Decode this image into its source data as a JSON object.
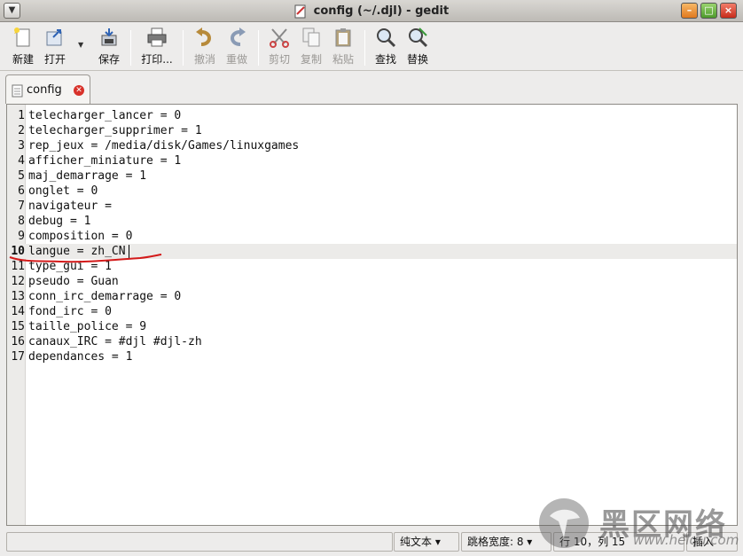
{
  "window": {
    "title": "config (~/.djl) - gedit"
  },
  "toolbar": {
    "new": "新建",
    "open": "打开",
    "save": "保存",
    "print": "打印...",
    "undo": "撤消",
    "redo": "重做",
    "cut": "剪切",
    "copy": "复制",
    "paste": "粘贴",
    "find": "查找",
    "replace": "替换"
  },
  "tab": {
    "label": "config"
  },
  "editor": {
    "current_line": 10,
    "lines": [
      {
        "n": "1",
        "text": "telecharger_lancer = 0"
      },
      {
        "n": "2",
        "text": "telecharger_supprimer = 1"
      },
      {
        "n": "3",
        "text": "rep_jeux = /media/disk/Games/linuxgames"
      },
      {
        "n": "4",
        "text": "afficher_miniature = 1"
      },
      {
        "n": "5",
        "text": "maj_demarrage = 1"
      },
      {
        "n": "6",
        "text": "onglet = 0"
      },
      {
        "n": "7",
        "text": "navigateur ="
      },
      {
        "n": "8",
        "text": "debug = 1"
      },
      {
        "n": "9",
        "text": "composition = 0"
      },
      {
        "n": "10",
        "text": "langue = zh_CN"
      },
      {
        "n": "11",
        "text": "type_gui = 1"
      },
      {
        "n": "12",
        "text": "pseudo = Guan"
      },
      {
        "n": "13",
        "text": "conn_irc_demarrage = 0"
      },
      {
        "n": "14",
        "text": "fond_irc = 0"
      },
      {
        "n": "15",
        "text": "taille_police = 9"
      },
      {
        "n": "16",
        "text": "canaux_IRC = #djl #djl-zh"
      },
      {
        "n": "17",
        "text": "dependances = 1"
      }
    ]
  },
  "statusbar": {
    "language": "纯文本 ▾",
    "tab_width": "跳格宽度: 8 ▾",
    "position": "行 10，列 15",
    "mode": "插入"
  },
  "watermark": {
    "brand": "黑区网络",
    "url": "www.heiqu.com"
  }
}
